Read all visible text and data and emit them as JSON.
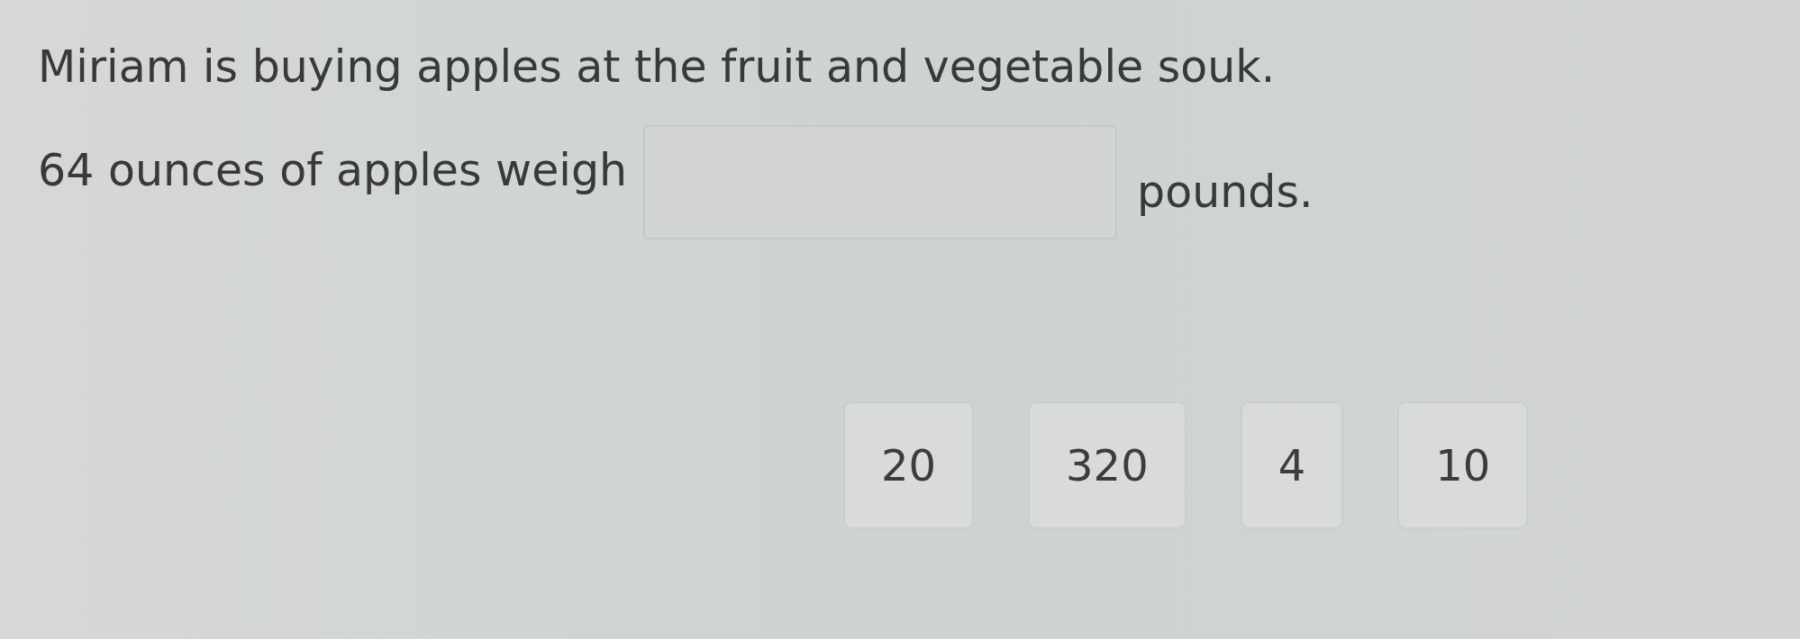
{
  "question": {
    "prompt": "Miriam is buying apples at the fruit and vegetable souk.",
    "sentence_start": "64 ounces of apples weigh",
    "sentence_end": "pounds."
  },
  "choices": [
    {
      "label": "20"
    },
    {
      "label": "320"
    },
    {
      "label": "4"
    },
    {
      "label": "10"
    }
  ]
}
